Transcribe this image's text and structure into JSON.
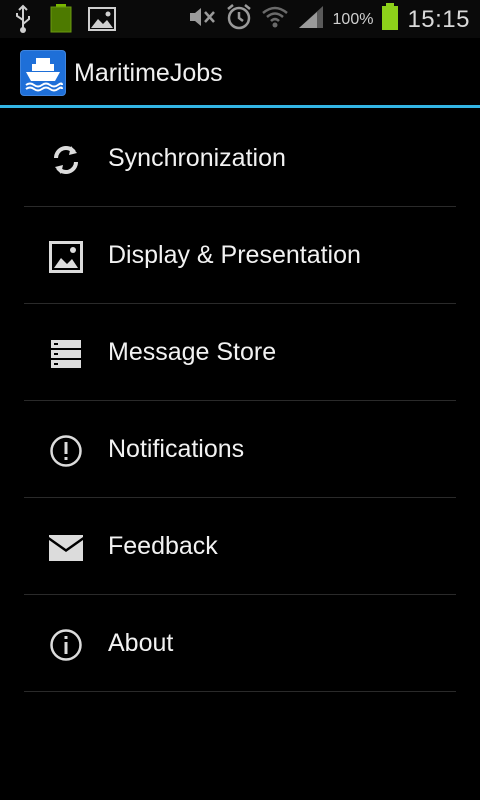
{
  "status_bar": {
    "battery_percent": "100%",
    "time": "15:15"
  },
  "action_bar": {
    "title": "MaritimeJobs",
    "accent_color": "#33b5e5",
    "logo_color": "#1e6fd8"
  },
  "menu": {
    "items": [
      {
        "label": "Synchronization",
        "icon": "sync-icon"
      },
      {
        "label": "Display & Presentation",
        "icon": "image-icon"
      },
      {
        "label": "Message Store",
        "icon": "storage-icon"
      },
      {
        "label": "Notifications",
        "icon": "alert-icon"
      },
      {
        "label": "Feedback",
        "icon": "mail-icon"
      },
      {
        "label": "About",
        "icon": "info-icon"
      }
    ]
  }
}
